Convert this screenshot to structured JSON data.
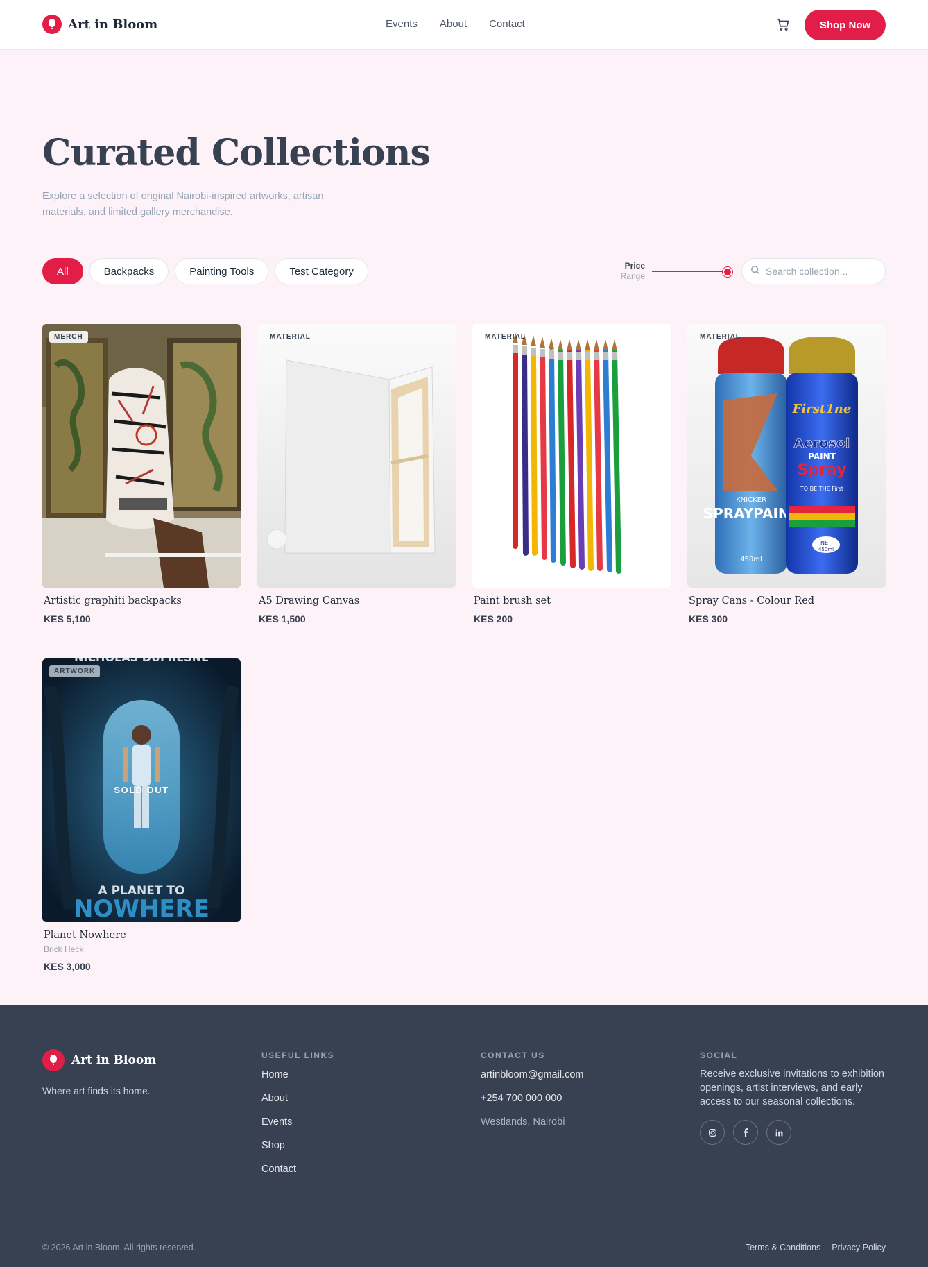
{
  "brand": {
    "name": "Art in Bloom",
    "accent": "#e11d48",
    "logo_icon": "balloon-icon"
  },
  "nav": {
    "items": [
      "Events",
      "About",
      "Contact"
    ],
    "cart_icon": "cart-icon",
    "cta": "Shop Now"
  },
  "hero": {
    "title": "Curated Collections",
    "subtitle": "Explore a selection of original Nairobi-inspired artworks, artisan materials, and limited gallery merchandise."
  },
  "filters": {
    "categories": [
      "All",
      "Backpacks",
      "Painting Tools",
      "Test Category"
    ],
    "active": "All",
    "price_label": "Price",
    "price_sub": "Range",
    "price_range_level": 0.95,
    "search_placeholder": "Search collection..."
  },
  "products": [
    {
      "badge": "MERCH",
      "name": "Artistic graphiti backpacks",
      "price": "KES 5,100"
    },
    {
      "badge": "MATERIAL",
      "name": "A5 Drawing Canvas",
      "price": "KES 1,500"
    },
    {
      "badge": "MATERIAL",
      "name": "Paint brush set",
      "price": "KES 200"
    },
    {
      "badge": "MATERIAL",
      "name": "Spray Cans - Colour Red",
      "price": "KES 300"
    },
    {
      "badge": "ARTWORK",
      "name": "Planet Nowhere",
      "artist": "Brick Heck",
      "price": "KES 3,000",
      "status": "SOLD OUT",
      "poster_top": "NICHOLAS DUFRESNE",
      "poster_line1": "A PLANET TO",
      "poster_line2": "NOWHERE"
    }
  ],
  "product_art": {
    "spray_can_1": {
      "brand": "SPRAYPAINT",
      "sub": "KNICKER",
      "volume": "450ml"
    },
    "spray_can_2": {
      "brand": "First1ne",
      "line1": "Aerosol",
      "line2": "PAINT",
      "line3": "Spray",
      "tag": "TO BE THE First",
      "net": "NET",
      "volume": "450ml"
    }
  },
  "footer": {
    "tagline": "Where art finds its home.",
    "useful_links_title": "USEFUL LINKS",
    "useful_links": [
      "Home",
      "About",
      "Events",
      "Shop",
      "Contact"
    ],
    "contact_title": "CONTACT US",
    "email": "artinbloom@gmail.com",
    "phone": "+254 700 000 000",
    "address": "Westlands, Nairobi",
    "social_title": "SOCIAL",
    "social_text": "Receive exclusive invitations to exhibition openings, artist interviews, and early access to our seasonal collections.",
    "social_icons": [
      "instagram-icon",
      "facebook-icon",
      "linkedin-icon"
    ],
    "copyright": "© 2026 Art in Bloom. All rights reserved.",
    "legal": [
      "Terms & Conditions",
      "Privacy Policy"
    ]
  }
}
